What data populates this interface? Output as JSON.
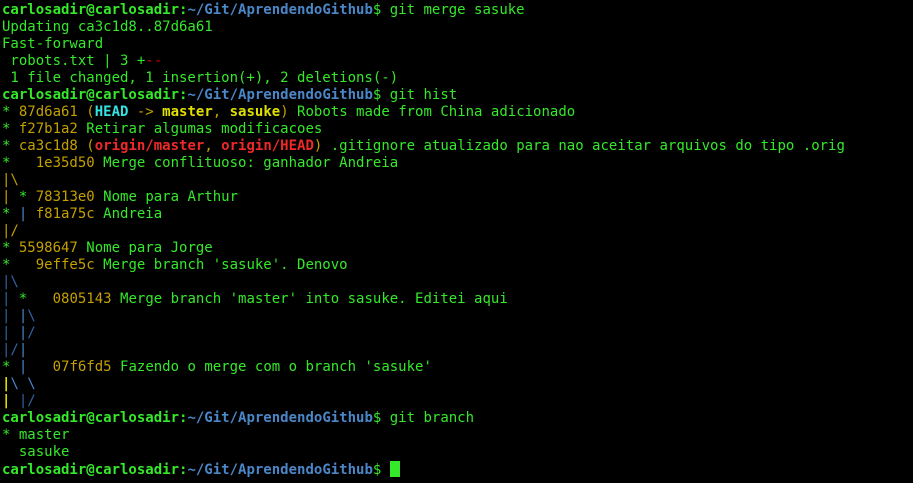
{
  "colors": {
    "background": "#000000",
    "text": "#35e82a",
    "prompt_user": "#35e82a",
    "prompt_path": "#4b87c8",
    "hash": "#c4a000",
    "head": "#34e2e2",
    "branch": "#e0e000",
    "remote": "#ef2929",
    "graph_yellow": "#c4a000",
    "graph_cyan": "#4b87c8",
    "graph_green": "#35e82a",
    "graph_blue": "#3465a4",
    "deletion": "#cc0000"
  },
  "terminal": {
    "lines": [
      [
        {
          "t": "carlosadir@carlosadir",
          "c": "prompt_user",
          "b": true
        },
        {
          "t": ":",
          "c": "text",
          "b": true
        },
        {
          "t": "~/Git/AprendendoGithub",
          "c": "prompt_path",
          "b": true
        },
        {
          "t": "$ git merge sasuke",
          "c": "text"
        }
      ],
      [
        {
          "t": "Updating ca3c1d8..87d6a61",
          "c": "text"
        }
      ],
      [
        {
          "t": "Fast-forward",
          "c": "text"
        }
      ],
      [
        {
          "t": " robots.txt | 3 ",
          "c": "text"
        },
        {
          "t": "+",
          "c": "text"
        },
        {
          "t": "--",
          "c": "deletion"
        }
      ],
      [
        {
          "t": " 1 file changed, 1 insertion(+), 2 deletions(-)",
          "c": "text"
        }
      ],
      [
        {
          "t": "carlosadir@carlosadir",
          "c": "prompt_user",
          "b": true
        },
        {
          "t": ":",
          "c": "text",
          "b": true
        },
        {
          "t": "~/Git/AprendendoGithub",
          "c": "prompt_path",
          "b": true
        },
        {
          "t": "$ git hist",
          "c": "text"
        }
      ],
      [
        {
          "t": "* ",
          "c": "text"
        },
        {
          "t": "87d6a61",
          "c": "hash"
        },
        {
          "t": " (",
          "c": "hash"
        },
        {
          "t": "HEAD",
          "c": "head",
          "b": true
        },
        {
          "t": " -> ",
          "c": "hash"
        },
        {
          "t": "master",
          "c": "branch",
          "b": true
        },
        {
          "t": ", ",
          "c": "hash"
        },
        {
          "t": "sasuke",
          "c": "branch",
          "b": true
        },
        {
          "t": ")",
          "c": "hash"
        },
        {
          "t": " Robots made from China adicionado",
          "c": "text"
        }
      ],
      [
        {
          "t": "* ",
          "c": "text"
        },
        {
          "t": "f27b1a2",
          "c": "hash"
        },
        {
          "t": " Retirar algumas modificacoes",
          "c": "text"
        }
      ],
      [
        {
          "t": "* ",
          "c": "text"
        },
        {
          "t": "ca3c1d8",
          "c": "hash"
        },
        {
          "t": " (",
          "c": "hash"
        },
        {
          "t": "origin/master",
          "c": "remote",
          "b": true
        },
        {
          "t": ", ",
          "c": "hash"
        },
        {
          "t": "origin/HEAD",
          "c": "remote",
          "b": true
        },
        {
          "t": ")",
          "c": "hash"
        },
        {
          "t": " .gitignore atualizado para nao aceitar arquivos do tipo .orig",
          "c": "text"
        }
      ],
      [
        {
          "t": "*   ",
          "c": "text"
        },
        {
          "t": "1e35d50",
          "c": "hash"
        },
        {
          "t": " Merge conflituoso: ganhador Andreia",
          "c": "text"
        }
      ],
      [
        {
          "t": "|\\",
          "c": "graph_yellow"
        }
      ],
      [
        {
          "t": "|",
          "c": "graph_yellow"
        },
        {
          "t": " * ",
          "c": "text"
        },
        {
          "t": "78313e0",
          "c": "hash"
        },
        {
          "t": " Nome para Arthur",
          "c": "text"
        }
      ],
      [
        {
          "t": "* ",
          "c": "text"
        },
        {
          "t": "| ",
          "c": "graph_cyan"
        },
        {
          "t": "f81a75c",
          "c": "hash"
        },
        {
          "t": " Andreia",
          "c": "text"
        }
      ],
      [
        {
          "t": "|/",
          "c": "graph_yellow"
        }
      ],
      [
        {
          "t": "* ",
          "c": "text"
        },
        {
          "t": "5598647",
          "c": "hash"
        },
        {
          "t": " Nome para Jorge",
          "c": "text"
        }
      ],
      [
        {
          "t": "*   ",
          "c": "text"
        },
        {
          "t": "9effe5c",
          "c": "hash"
        },
        {
          "t": " Merge branch 'sasuke'. Denovo",
          "c": "text"
        }
      ],
      [
        {
          "t": "|\\",
          "c": "graph_blue"
        }
      ],
      [
        {
          "t": "|",
          "c": "graph_blue"
        },
        {
          "t": " *   ",
          "c": "text"
        },
        {
          "t": "0805143",
          "c": "hash"
        },
        {
          "t": " Merge branch 'master' into sasuke. Editei aqui",
          "c": "text"
        }
      ],
      [
        {
          "t": "|",
          "c": "graph_blue"
        },
        {
          "t": " |",
          "c": "graph_cyan"
        },
        {
          "t": "\\",
          "c": "graph_blue"
        }
      ],
      [
        {
          "t": "|",
          "c": "graph_blue"
        },
        {
          "t": " |",
          "c": "graph_cyan"
        },
        {
          "t": "/",
          "c": "graph_blue"
        }
      ],
      [
        {
          "t": "|/",
          "c": "graph_blue"
        },
        {
          "t": "|",
          "c": "graph_cyan"
        }
      ],
      [
        {
          "t": "* ",
          "c": "text"
        },
        {
          "t": "|",
          "c": "graph_cyan"
        },
        {
          "t": "   ",
          "c": "text"
        },
        {
          "t": "07f6fd5",
          "c": "hash"
        },
        {
          "t": " Fazendo o merge com o branch 'sasuke'",
          "c": "text"
        }
      ],
      [
        {
          "t": "|",
          "c": "branch",
          "b": true
        },
        {
          "t": "\\ \\",
          "c": "graph_cyan"
        }
      ],
      [
        {
          "t": "|",
          "c": "branch",
          "b": true
        },
        {
          "t": " |/",
          "c": "graph_blue"
        }
      ],
      [
        {
          "t": "carlosadir@carlosadir",
          "c": "prompt_user",
          "b": true
        },
        {
          "t": ":",
          "c": "text",
          "b": true
        },
        {
          "t": "~/Git/AprendendoGithub",
          "c": "prompt_path",
          "b": true
        },
        {
          "t": "$ git branch",
          "c": "text"
        }
      ],
      [
        {
          "t": "* master",
          "c": "text"
        }
      ],
      [
        {
          "t": "  sasuke",
          "c": "text"
        }
      ],
      [
        {
          "t": "carlosadir@carlosadir",
          "c": "prompt_user",
          "b": true
        },
        {
          "t": ":",
          "c": "text",
          "b": true
        },
        {
          "t": "~/Git/AprendendoGithub",
          "c": "prompt_path",
          "b": true
        },
        {
          "t": "$ ",
          "c": "text"
        },
        {
          "t": "",
          "c": "text",
          "cursor": true
        }
      ]
    ]
  }
}
